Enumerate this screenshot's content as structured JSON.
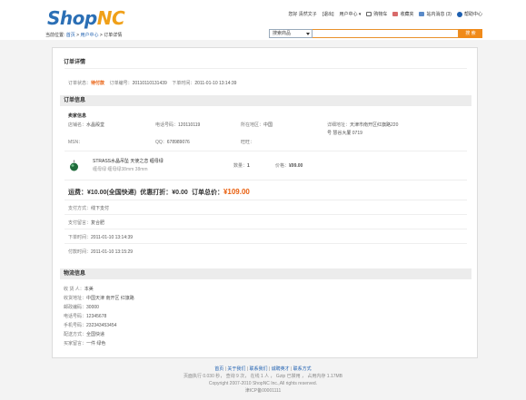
{
  "logo": {
    "shop": "Shop",
    "nc": "NC"
  },
  "toplinks": {
    "greeting": "您好 清然文子",
    "logout": "[退出]",
    "user_center": "用户中心",
    "cart": "购物车",
    "favorites": "收藏夹",
    "messages": "站内消息",
    "messages_count": "(3)",
    "help": "帮助中心"
  },
  "breadcrumb": {
    "prefix": "当前位置:",
    "home": "首页",
    "sep1": " > ",
    "user_center": "用户中心",
    "sep2": " > ",
    "current": "订单详情"
  },
  "search": {
    "select_value": "搜索商品",
    "button": "搜 索"
  },
  "order": {
    "section_title": "订单详情",
    "status_label": "订单状态：",
    "status_value": "待付款",
    "number_label": "订单编号：",
    "number_value": "20110110131439",
    "time_label": "下单时间：",
    "time_value": "2011-01-10 13:14:39"
  },
  "order_info": {
    "title": "订单信息",
    "seller_title": "卖家信息",
    "shop_label": "店铺名：",
    "shop_value": "水晶殿堂",
    "phone_label": "电话号码：",
    "phone_value": "120110119",
    "region_label": "所在地区：",
    "region_value": "中国",
    "address_label": "详细地址：",
    "address_value_1": "天津市南开区红旗路220",
    "address_value_2": "号 慧谷大厦 0719",
    "msn_label": "MSN：",
    "qq_label": "QQ：",
    "qq_value": "678989076",
    "wangwang_label": "旺旺："
  },
  "product": {
    "name": "STRASS水晶吊坠 天使之恋 缠母绿",
    "spec": "缠母绿 缠母绿38mm 38mm",
    "qty_label": "数量：",
    "qty_value": "1",
    "price_label": "价格：",
    "price_value": "¥99.00"
  },
  "totals": {
    "shipping_label": "运费：",
    "shipping_value": "¥10.00(全国快递)",
    "discount_label": "优惠打折：",
    "discount_value": "¥0.00",
    "total_label": "订单总价：",
    "total_value": "¥109.00"
  },
  "payment": {
    "method_label": "支付方式：",
    "method_value": "线下支付",
    "note_label": "支付留言：",
    "note_value": "复合肥",
    "order_time_label": "下单时间：",
    "order_time_value": "2011-01-10 13:14:39",
    "pay_time_label": "付款时间：",
    "pay_time_value": "2011-01-10 13:15:29"
  },
  "logistics": {
    "title": "物流信息",
    "receiver_label": "收 货 人：",
    "receiver_value": "本美",
    "address_label": "收货地址：",
    "address_value": "中国天津 南开区 红旗路",
    "zip_label": "邮政编码：",
    "zip_value": "30000",
    "phone_label": "电话号码：",
    "phone_value": "12345678",
    "mobile_label": "手机号码：",
    "mobile_value": "232343453454",
    "delivery_label": "配送方式：",
    "delivery_value": "全国快递",
    "buyer_note_label": "买家留言：",
    "buyer_note_value": "一件 绿色"
  },
  "footer": {
    "links": [
      "首页",
      "关于我们",
      "联系我们",
      "诚聘英才",
      "联系方式"
    ],
    "stats": "页面执行 0.030 秒， 查询 9 次， 在线 1 人 ， Gzip 已禁用 ， 占用内存 1.17MB",
    "copyright": "Copyright 2007-2010 ShopNC Inc.,All rights reserved.",
    "icp": "津ICP备00001111"
  },
  "colors": {
    "accent": "#e9600f",
    "brand_blue": "#2b6fb5",
    "brand_orange": "#f0a019",
    "link": "#1d5fb0"
  }
}
